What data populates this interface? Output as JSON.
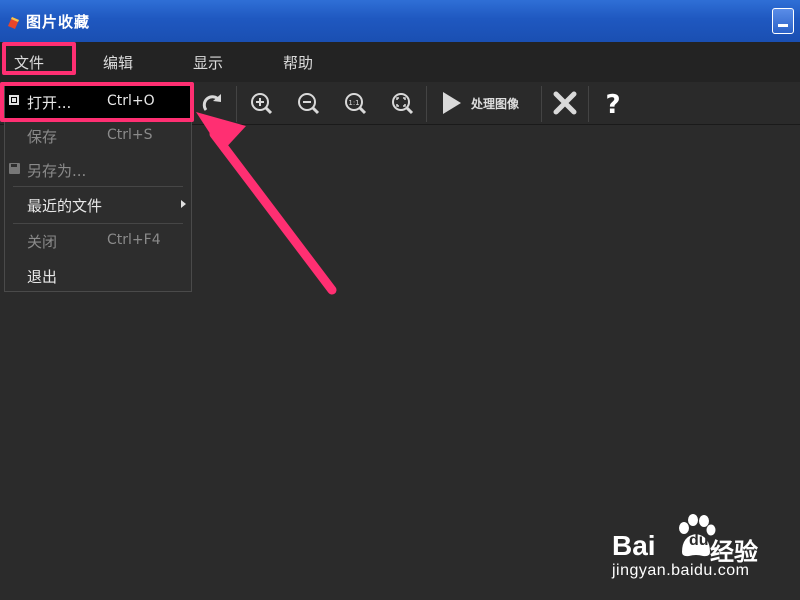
{
  "window": {
    "title": "图片收藏",
    "app_icon": "app-photo-icon"
  },
  "menubar": {
    "items": [
      {
        "label": "文件"
      },
      {
        "label": "编辑"
      },
      {
        "label": "显示"
      },
      {
        "label": "帮助"
      }
    ]
  },
  "toolbar": {
    "icons": [
      "rotate-right-icon",
      "zoom-in-icon",
      "zoom-out-icon",
      "actual-size-icon",
      "fit-window-icon",
      "play-icon",
      "close-x-icon",
      "help-icon"
    ],
    "process_label": "处理图像"
  },
  "file_menu": {
    "items": [
      {
        "label": "打开...",
        "shortcut": "Ctrl+O",
        "enabled": true,
        "selected": true
      },
      {
        "label": "保存",
        "shortcut": "Ctrl+S",
        "enabled": false
      },
      {
        "label": "另存为...",
        "shortcut": "",
        "enabled": false
      },
      {
        "label": "最近的文件",
        "shortcut": "",
        "enabled": true,
        "submenu": true
      },
      {
        "label": "关闭",
        "shortcut": "Ctrl+F4",
        "enabled": false
      },
      {
        "label": "退出",
        "shortcut": "",
        "enabled": true
      }
    ]
  },
  "annotation": {
    "highlight_color": "#ff2f72"
  },
  "watermark": {
    "brand_bai": "Bai",
    "brand_du": "du",
    "brand_jingyan": "经验",
    "url": "jingyan.baidu.com"
  },
  "colors": {
    "titlebar": "#1f58c0",
    "background": "#2b2b2b",
    "menubar": "#232323"
  }
}
